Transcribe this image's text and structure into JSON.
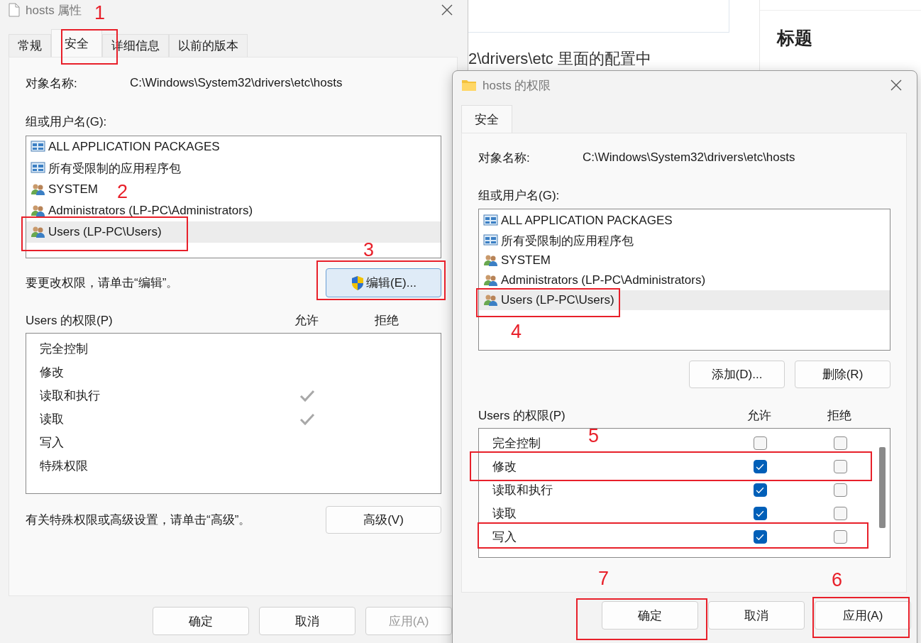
{
  "background_page": {
    "text": "2\\drivers\\etc 里面的配置中",
    "heading": "标题"
  },
  "properties_dialog": {
    "title": "hosts 属性",
    "tabs": [
      {
        "label": "常规",
        "selected": false
      },
      {
        "label": "安全",
        "selected": true
      },
      {
        "label": "详细信息",
        "selected": false
      },
      {
        "label": "以前的版本",
        "selected": false
      }
    ],
    "object_label": "对象名称:",
    "object_path": "C:\\Windows\\System32\\drivers\\etc\\hosts",
    "group_label": "组或用户名(G):",
    "groups": [
      {
        "name": "ALL APPLICATION PACKAGES",
        "kind": "package",
        "selected": false
      },
      {
        "name": "所有受限制的应用程序包",
        "kind": "package",
        "selected": false
      },
      {
        "name": "SYSTEM",
        "kind": "user",
        "selected": false
      },
      {
        "name": "Administrators (LP-PC\\Administrators)",
        "kind": "user",
        "selected": false
      },
      {
        "name": "Users (LP-PC\\Users)",
        "kind": "user",
        "selected": true
      }
    ],
    "edit_hint": "要更改权限，请单击“编辑”。",
    "edit_button": "编辑(E)...",
    "permissions_label": "Users 的权限(P)",
    "allow_header": "允许",
    "deny_header": "拒绝",
    "permissions": [
      {
        "name": "完全控制",
        "allow": false
      },
      {
        "name": "修改",
        "allow": false
      },
      {
        "name": "读取和执行",
        "allow": true
      },
      {
        "name": "读取",
        "allow": true
      },
      {
        "name": "写入",
        "allow": false
      },
      {
        "name": "特殊权限",
        "allow": false
      }
    ],
    "advanced_hint": "有关特殊权限或高级设置，请单击“高级”。",
    "advanced_button": "高级(V)",
    "buttons": [
      {
        "label": "确定",
        "disabled": false
      },
      {
        "label": "取消",
        "disabled": false
      },
      {
        "label": "应用(A)",
        "disabled": true
      }
    ]
  },
  "permissions_dialog": {
    "title": "hosts 的权限",
    "tab": "安全",
    "object_label": "对象名称:",
    "object_path": "C:\\Windows\\System32\\drivers\\etc\\hosts",
    "group_label": "组或用户名(G):",
    "groups": [
      {
        "name": "ALL APPLICATION PACKAGES",
        "kind": "package",
        "selected": false
      },
      {
        "name": "所有受限制的应用程序包",
        "kind": "package",
        "selected": false
      },
      {
        "name": "SYSTEM",
        "kind": "user",
        "selected": false
      },
      {
        "name": "Administrators (LP-PC\\Administrators)",
        "kind": "user",
        "selected": false
      },
      {
        "name": "Users (LP-PC\\Users)",
        "kind": "user",
        "selected": true
      }
    ],
    "add_button": "添加(D)...",
    "remove_button": "删除(R)",
    "permissions_label": "Users 的权限(P)",
    "allow_header": "允许",
    "deny_header": "拒绝",
    "permissions": [
      {
        "name": "完全控制",
        "allow": false,
        "deny": false
      },
      {
        "name": "修改",
        "allow": true,
        "deny": false
      },
      {
        "name": "读取和执行",
        "allow": true,
        "deny": false
      },
      {
        "name": "读取",
        "allow": true,
        "deny": false
      },
      {
        "name": "写入",
        "allow": true,
        "deny": false
      }
    ],
    "buttons": [
      {
        "label": "确定"
      },
      {
        "label": "取消"
      },
      {
        "label": "应用(A)"
      }
    ]
  },
  "annotations": [
    {
      "number": "1"
    },
    {
      "number": "2"
    },
    {
      "number": "3"
    },
    {
      "number": "4"
    },
    {
      "number": "5"
    },
    {
      "number": "6"
    },
    {
      "number": "7"
    }
  ]
}
